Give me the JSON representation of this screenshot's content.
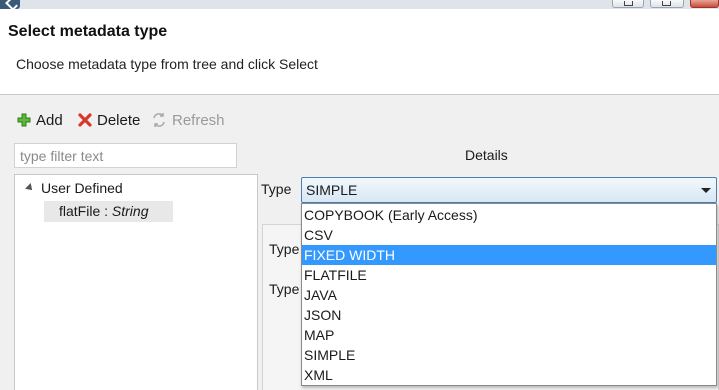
{
  "window": {
    "title_icon": "eclipse-app-icon"
  },
  "header": {
    "title": "Select metadata type",
    "subtitle": "Choose metadata type from tree and click Select"
  },
  "toolbar": {
    "add_label": "Add",
    "delete_label": "Delete",
    "refresh_label": "Refresh",
    "add_icon": "plus-icon",
    "delete_icon": "x-icon",
    "refresh_icon": "refresh-icon"
  },
  "filter": {
    "placeholder": "type filter text",
    "value": ""
  },
  "tree": {
    "root_label": "User Defined",
    "leaf_name": "flatFile : ",
    "leaf_type": "String"
  },
  "details": {
    "label": "Details",
    "type_label": "Type",
    "selected_type": "SIMPLE",
    "panel_labels": [
      "Type",
      "Type"
    ]
  },
  "dropdown": {
    "options": [
      "COPYBOOK (Early Access)",
      "CSV",
      "FIXED WIDTH",
      "FLATFILE",
      "JAVA",
      "JSON",
      "MAP",
      "SIMPLE",
      "XML"
    ],
    "highlighted": "FIXED WIDTH"
  },
  "colors": {
    "highlight": "#3399ff",
    "combo_border": "#4a7fb0",
    "add_green": "#3c9a28",
    "delete_red": "#d9362b"
  }
}
